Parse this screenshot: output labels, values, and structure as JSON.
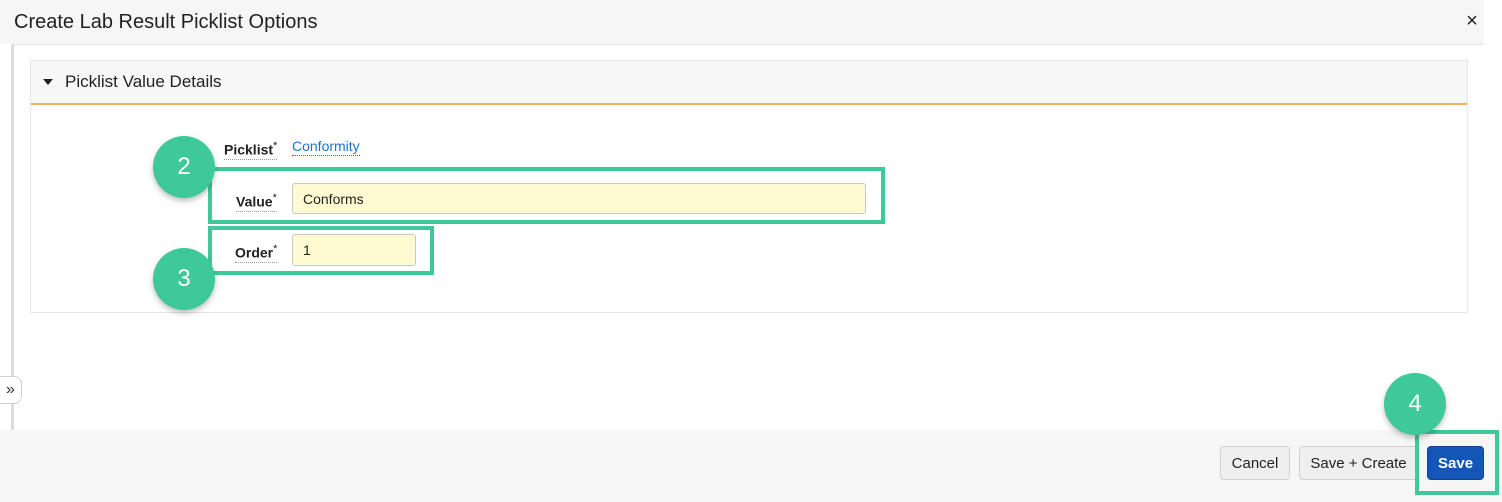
{
  "dialog": {
    "title": "Create Lab Result Picklist Options",
    "close_icon": "×",
    "expand_icon": "»"
  },
  "section": {
    "title": "Picklist Value Details"
  },
  "form": {
    "picklist_label": "Picklist",
    "picklist_value": "Conformity",
    "value_label": "Value",
    "value_value": "Conforms",
    "order_label": "Order",
    "order_value": "1",
    "required_mark": "*"
  },
  "footer": {
    "cancel": "Cancel",
    "save_create": "Save + Create",
    "save": "Save"
  },
  "markers": {
    "step2": "2",
    "step3": "3",
    "step4": "4"
  },
  "colors": {
    "highlight": "#3fc99b",
    "primary_button": "#1456b8",
    "section_underline": "#f0b35a",
    "input_background": "#fefbd2",
    "link": "#1a73c9"
  }
}
